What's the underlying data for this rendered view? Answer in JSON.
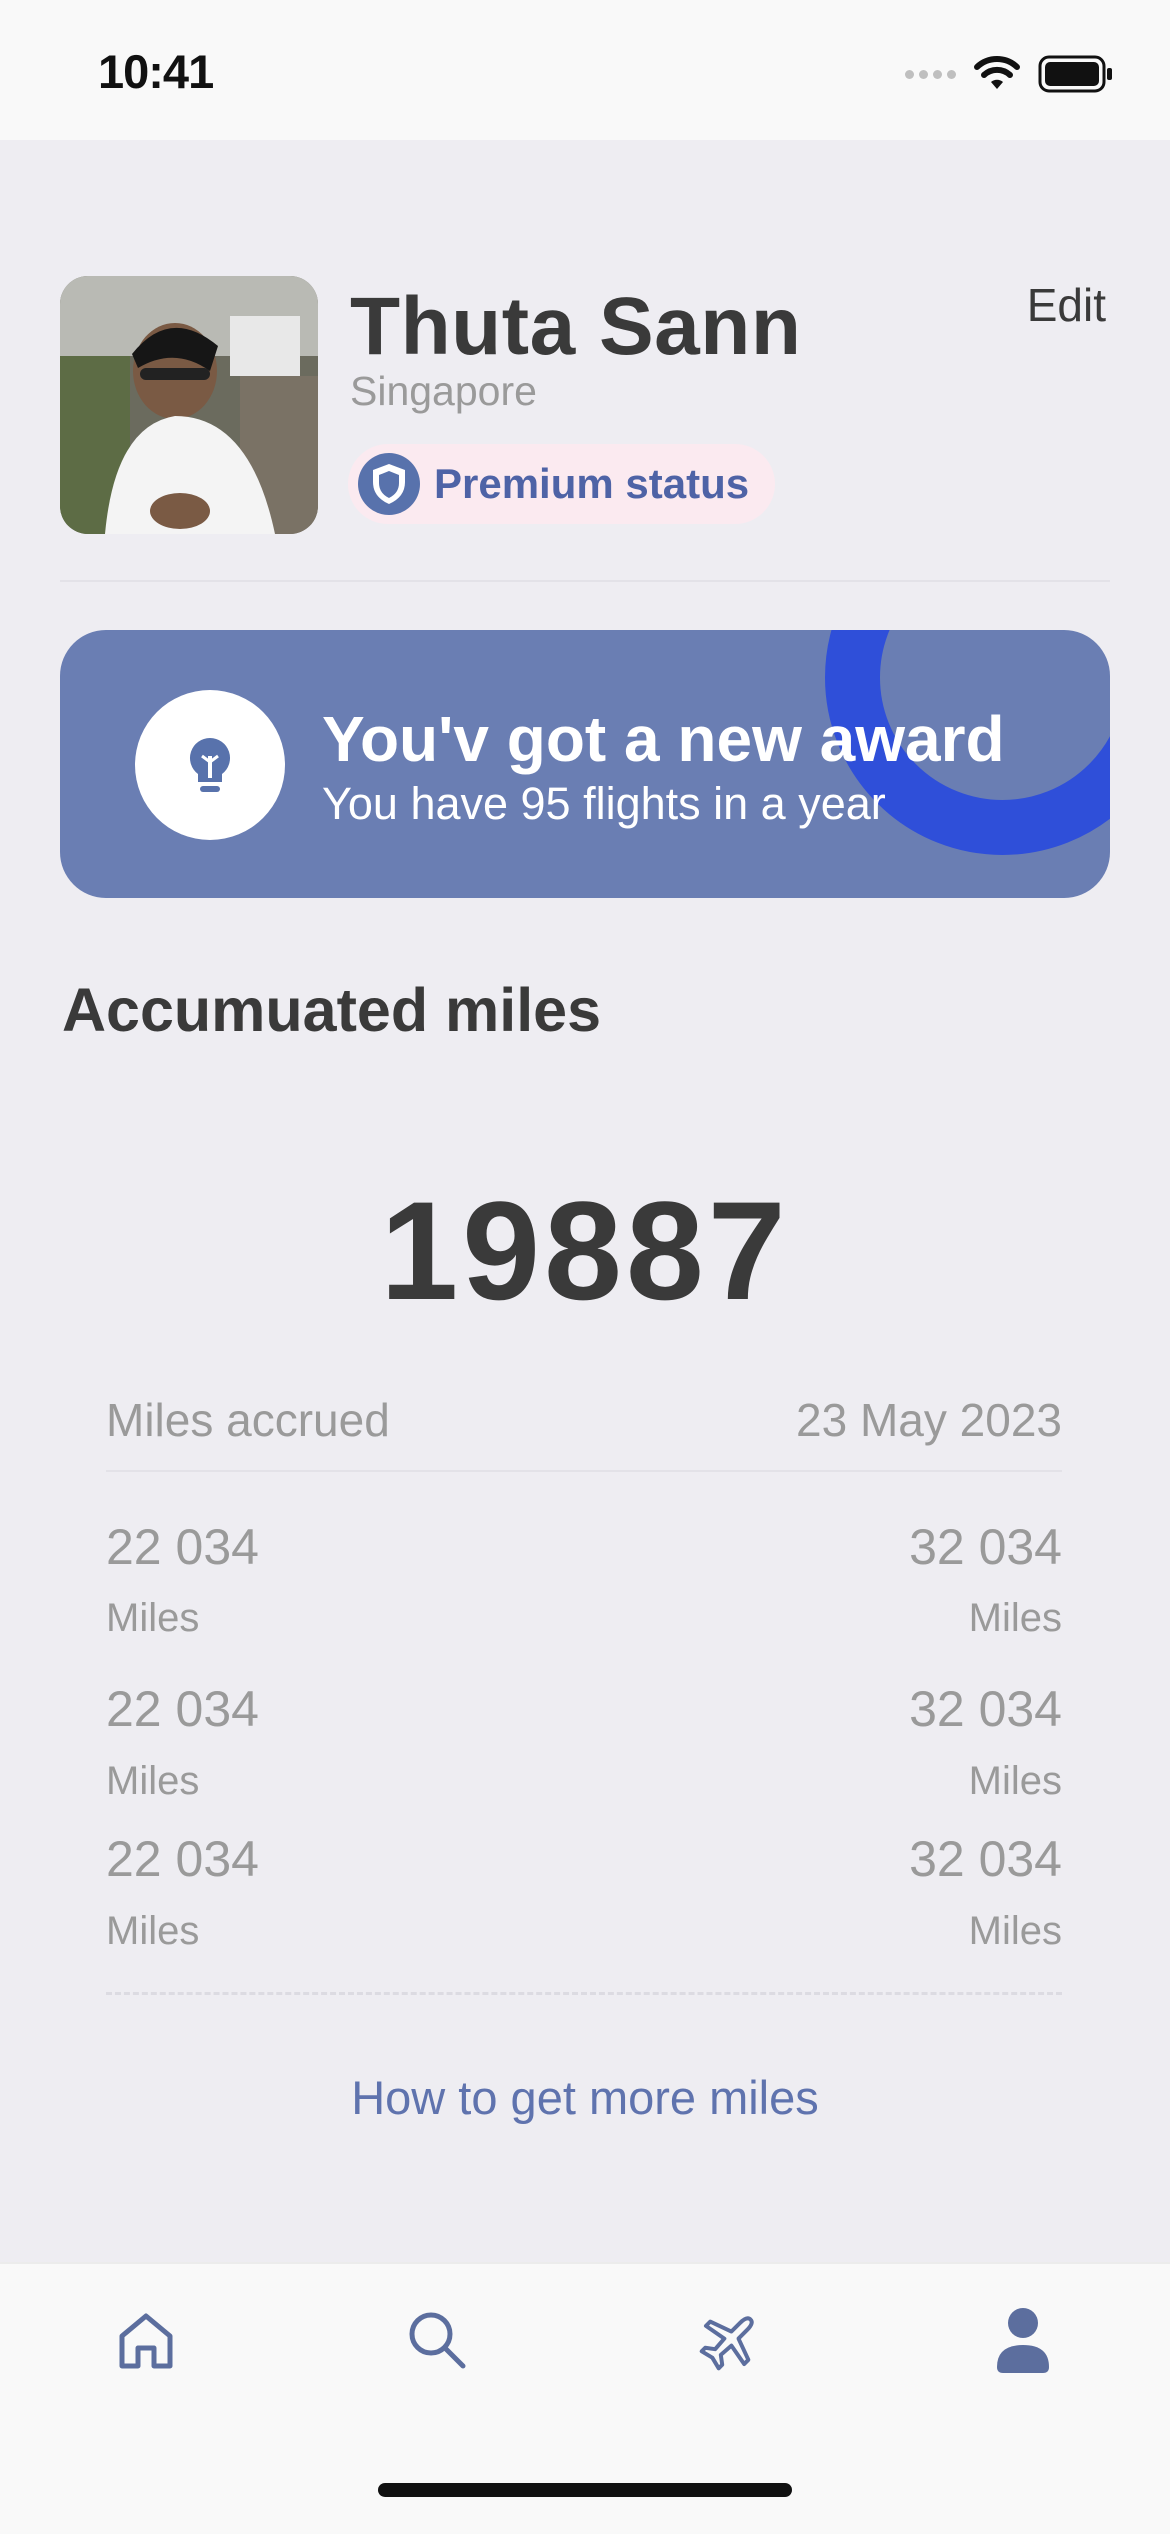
{
  "status_bar": {
    "time": "10:41"
  },
  "profile": {
    "name": "Thuta Sann",
    "location": "Singapore",
    "edit_label": "Edit",
    "status_badge": "Premium status"
  },
  "award": {
    "title": "You'v got a new award",
    "subtitle": "You have 95 flights in a year"
  },
  "miles": {
    "section_title": "Accumuated miles",
    "total": "19887",
    "header_left": "Miles accrued",
    "header_right": "23 May 2023",
    "rows": [
      {
        "left_value": "22 034",
        "left_unit": "Miles",
        "right_value": "32 034",
        "right_unit": "Miles"
      },
      {
        "left_value": "22 034",
        "left_unit": "Miles",
        "right_value": "32 034",
        "right_unit": "Miles"
      },
      {
        "left_value": "22 034",
        "left_unit": "Miles",
        "right_value": "32 034",
        "right_unit": "Miles"
      }
    ],
    "more_link": "How to get more miles"
  },
  "tab_bar": {
    "tabs": [
      {
        "icon": "home-icon"
      },
      {
        "icon": "search-icon"
      },
      {
        "icon": "airplane-icon"
      },
      {
        "icon": "profile-icon",
        "active": true
      }
    ]
  },
  "colors": {
    "accent": "#6A7EB3",
    "link": "#5F73AE",
    "badge_bg": "#FBEAF0",
    "background": "#EEEDF2"
  }
}
